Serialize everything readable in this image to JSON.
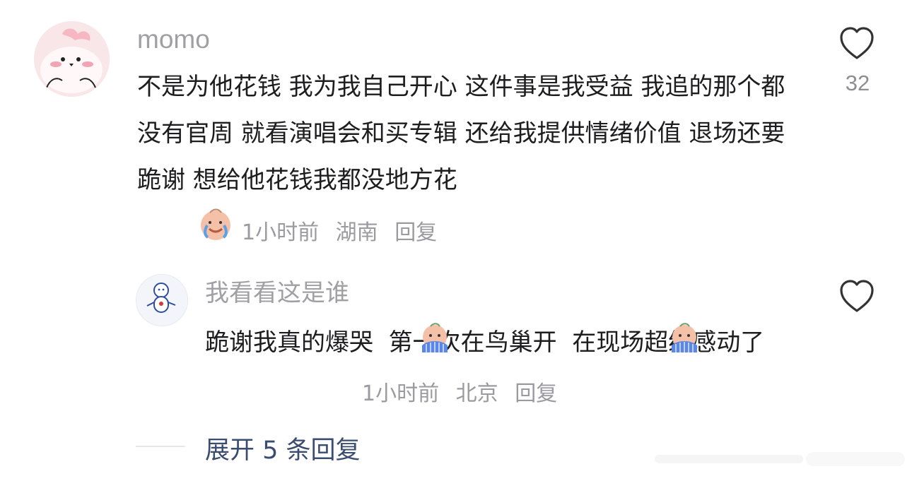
{
  "comment": {
    "username": "momo",
    "text": "不是为他花钱 我为我自己开心 这件事是我受益 我追的那个都没有官周 就看演唱会和买专辑 还给我提供情绪价值 退场还要跪谢 想给他花钱我都没地方花",
    "emoji_icon": "crying-emoji-icon",
    "time": "1小时前",
    "location": "湖南",
    "reply_label": "回复",
    "like_count": "32"
  },
  "reply": {
    "username": "我看看这是谁",
    "text": "跪谢我真的爆哭  第一次在鸟巢开  在现场超级感动了",
    "emoji_icon": "crying-emoji-icon",
    "time": "1小时前",
    "location": "北京",
    "reply_label": "回复"
  },
  "expand_replies": {
    "label": "展开 5 条回复"
  },
  "colors": {
    "username": "#a0a0a4",
    "meta": "#9a9aa0",
    "link": "#3a4c70"
  }
}
